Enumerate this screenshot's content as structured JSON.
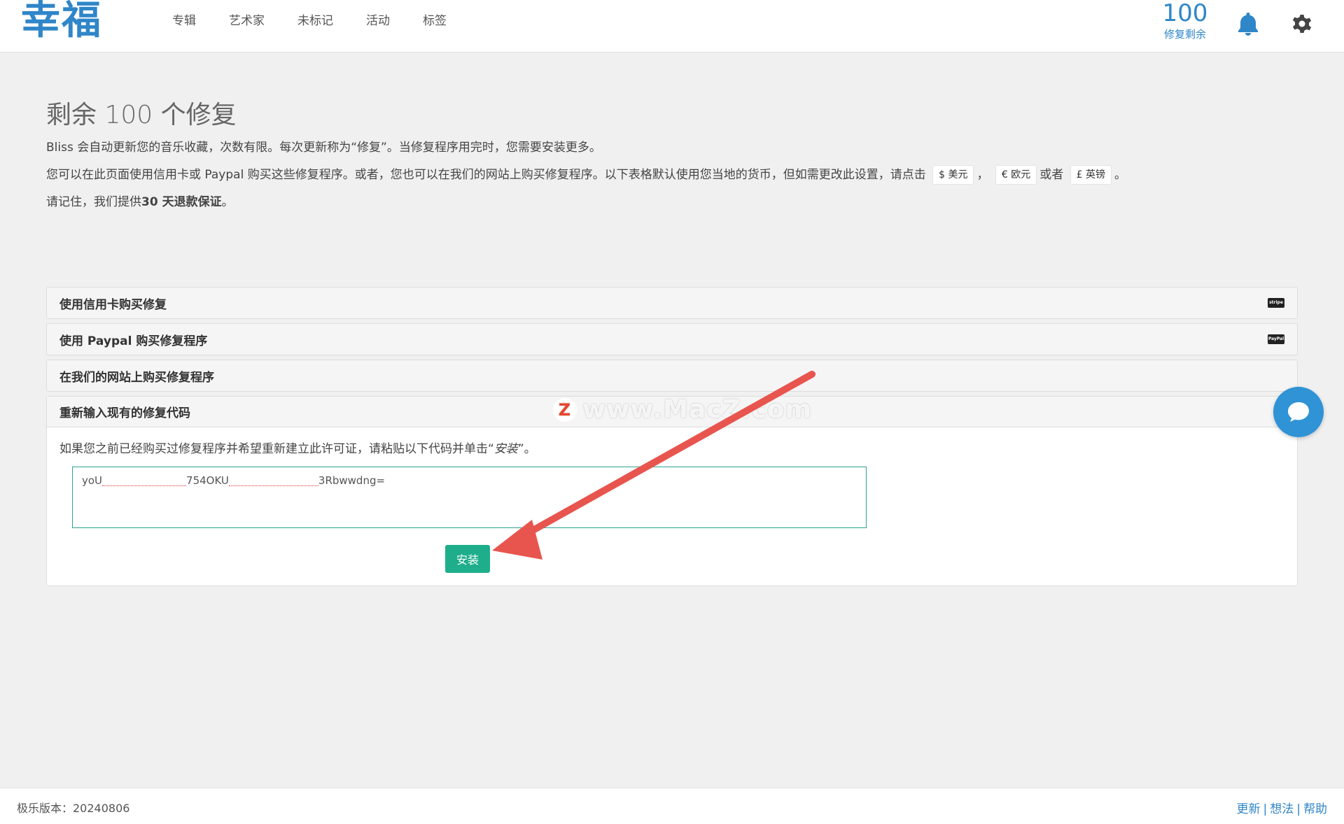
{
  "app": {
    "logo": "幸福"
  },
  "nav": {
    "items": [
      "专辑",
      "艺术家",
      "未标记",
      "活动",
      "标签"
    ]
  },
  "header": {
    "fixes_count": "100",
    "fixes_label": "修复剩余",
    "icons": [
      "bell-icon",
      "gear-icon"
    ]
  },
  "intro": {
    "title": "剩余 100 个修复",
    "p1": "Bliss 会自动更新您的音乐收藏，次数有限。每次更新称为“修复”。当修复程序用完时，您需要安装更多。",
    "p2_prefix": "您可以在此页面使用信用卡或 Paypal 购买这些修复程序。或者，您也可以在我们的网站上购买修复程序。以下表格默认使用您当地的货币，但如需更改此设置，请点击",
    "currency_usd_symbol": "$",
    "currency_usd": "美元",
    "comma": "，",
    "currency_eur_symbol": "€",
    "currency_eur": "欧元",
    "or": "或者",
    "currency_gbp_symbol": "£",
    "currency_gbp": "英镑",
    "period": "。",
    "p3_prefix": "请记住，我们提供",
    "p3_bold": "30 天退款保证",
    "p3_suffix": "。"
  },
  "accordion": {
    "credit_card": "使用信用卡购买修复",
    "credit_card_badge": "stripe",
    "paypal": "使用 Paypal 购买修复程序",
    "paypal_badge": "PayPal",
    "website": "在我们的网站上购买修复程序",
    "reenter": "重新输入现有的修复代码",
    "reenter_text_prefix": "如果您之前已经购买过修复程序并希望重新建立此许可证，请粘贴以下代码并单击“",
    "reenter_text_em": "安装",
    "reenter_text_suffix": "”。",
    "code_part1": "yoU",
    "code_part2": "754OKU",
    "code_part3": "3Rbwwdng=",
    "install_label": "安装"
  },
  "watermark": {
    "logo_letter": "Z",
    "text": "www.MacZ.com"
  },
  "footer": {
    "version": "极乐版本：20240806",
    "links": [
      "更新",
      "想法",
      "帮助"
    ],
    "separator": "|"
  },
  "colors": {
    "brand": "#2f86c8",
    "install": "#1fae8b",
    "arrow": "#e8554e"
  }
}
